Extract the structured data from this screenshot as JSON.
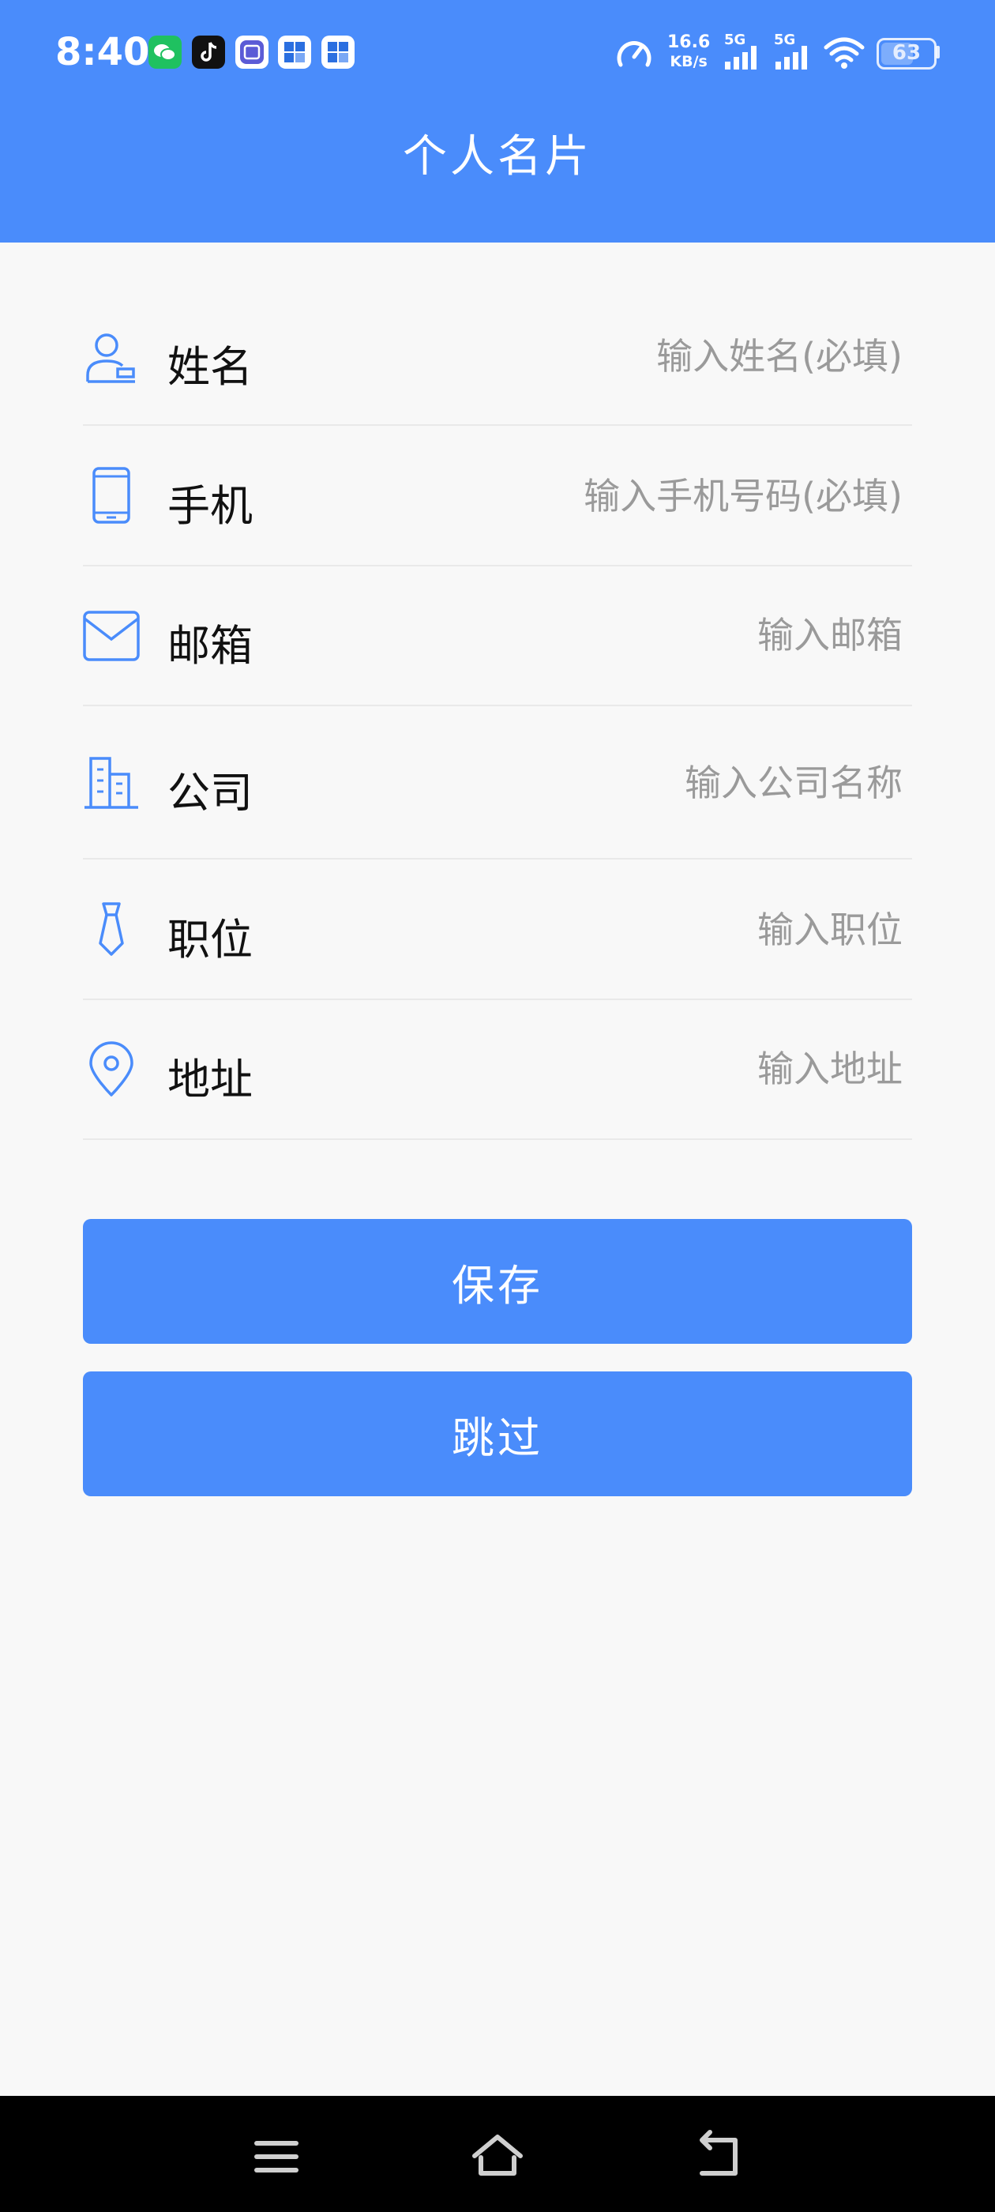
{
  "status_bar": {
    "time": "8:40",
    "speed_value": "16.6",
    "speed_unit": "KB/s",
    "network_1": "5G",
    "network_2": "5G",
    "battery": "63",
    "notification_icons": [
      "wechat-icon",
      "tiktok-icon",
      "tieba-icon",
      "app-grid-icon",
      "app-grid-icon"
    ]
  },
  "header": {
    "title": "个人名片"
  },
  "form": {
    "fields": [
      {
        "icon": "person-icon",
        "label": "姓名",
        "placeholder": "输入姓名(必填)",
        "value": ""
      },
      {
        "icon": "phone-icon",
        "label": "手机",
        "placeholder": "输入手机号码(必填)",
        "value": ""
      },
      {
        "icon": "mail-icon",
        "label": "邮箱",
        "placeholder": "输入邮箱",
        "value": ""
      },
      {
        "icon": "building-icon",
        "label": "公司",
        "placeholder": "输入公司名称",
        "value": ""
      },
      {
        "icon": "tie-icon",
        "label": "职位",
        "placeholder": "输入职位",
        "value": ""
      },
      {
        "icon": "location-icon",
        "label": "地址",
        "placeholder": "输入地址",
        "value": ""
      }
    ]
  },
  "actions": {
    "save_label": "保存",
    "skip_label": "跳过"
  },
  "colors": {
    "primary": "#4a8cfb",
    "background": "#f8f8f8",
    "placeholder": "#9a9a9a"
  }
}
